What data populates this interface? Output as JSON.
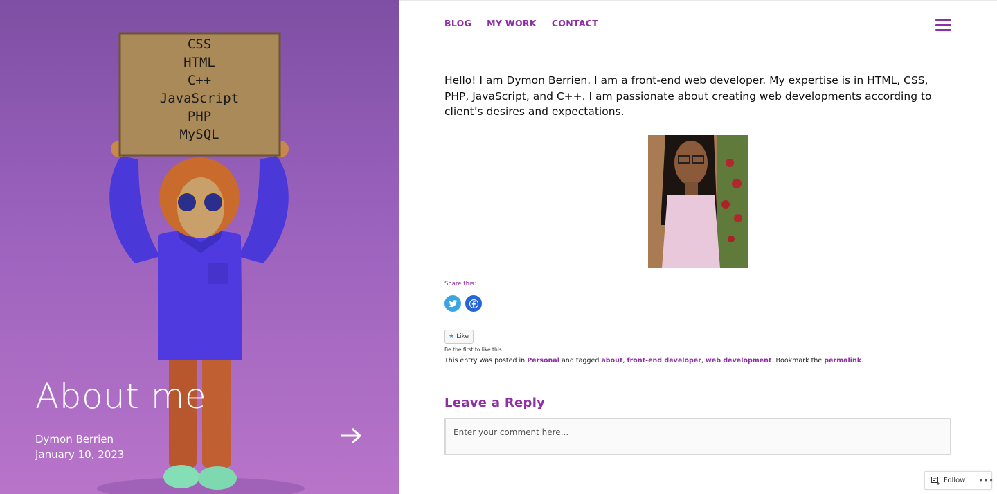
{
  "hero": {
    "title": "About me",
    "author": "Dymon Berrien",
    "date": "January 10, 2023",
    "sign_lines": [
      "CSS",
      "HTML",
      "C++",
      "JavaScript",
      "PHP",
      "MySQL"
    ]
  },
  "nav": {
    "items": [
      {
        "label": "BLOG"
      },
      {
        "label": "MY WORK"
      },
      {
        "label": "CONTACT"
      }
    ]
  },
  "post": {
    "intro": "Hello! I am Dymon Berrien. I am a front-end web developer. My expertise is in HTML, CSS, PHP, JavaScript, and C++. I am passionate about creating web developments according to client’s desires and expectations.",
    "share_label": "Share this:",
    "like_label": "Like",
    "like_note": "Be the first to like this.",
    "meta": {
      "prefix": "This entry was posted in",
      "category": "Personal",
      "tagged_text": "and tagged",
      "tags": [
        "about",
        "front-end developer",
        "web development"
      ],
      "bookmark_text": ". Bookmark the",
      "permalink": "permalink",
      "suffix": "."
    }
  },
  "reply": {
    "title": "Leave a Reply",
    "placeholder": "Enter your comment here..."
  },
  "follow": {
    "label": "Follow",
    "more": "•••"
  },
  "colors": {
    "accent": "#8e2fa4",
    "hero_top": "#7e4fa4",
    "hero_bottom": "#b874c9",
    "twitter": "#3aa5e6",
    "facebook": "#2566d7"
  }
}
